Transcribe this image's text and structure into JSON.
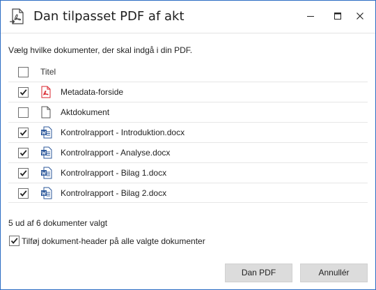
{
  "window": {
    "title": "Dan tilpasset PDF af akt",
    "icon": "pdf-export-icon"
  },
  "instruction": "Vælg hvilke dokumenter, der skal indgå i din PDF.",
  "table": {
    "header": {
      "title": "Titel",
      "checked": false
    },
    "rows": [
      {
        "label": "Metadata-forside",
        "checked": true,
        "icon": "pdf-file-icon"
      },
      {
        "label": "Aktdokument",
        "checked": false,
        "icon": "blank-file-icon"
      },
      {
        "label": "Kontrolrapport - Introduktion.docx",
        "checked": true,
        "icon": "word-file-icon"
      },
      {
        "label": "Kontrolrapport - Analyse.docx",
        "checked": true,
        "icon": "word-file-icon"
      },
      {
        "label": "Kontrolrapport - Bilag 1.docx",
        "checked": true,
        "icon": "word-file-icon"
      },
      {
        "label": "Kontrolrapport - Bilag 2.docx",
        "checked": true,
        "icon": "word-file-icon"
      }
    ]
  },
  "summary": "5 ud af 6 dokumenter valgt",
  "option": {
    "label": "Tilføj dokument-header på alle valgte dokumenter",
    "checked": true
  },
  "buttons": {
    "ok": "Dan PDF",
    "cancel": "Annullér"
  },
  "colors": {
    "accent_border": "#2b6cc4",
    "pdf_red": "#d9232b",
    "word_blue": "#2b579a",
    "button_bg": "#dcdcdc"
  }
}
